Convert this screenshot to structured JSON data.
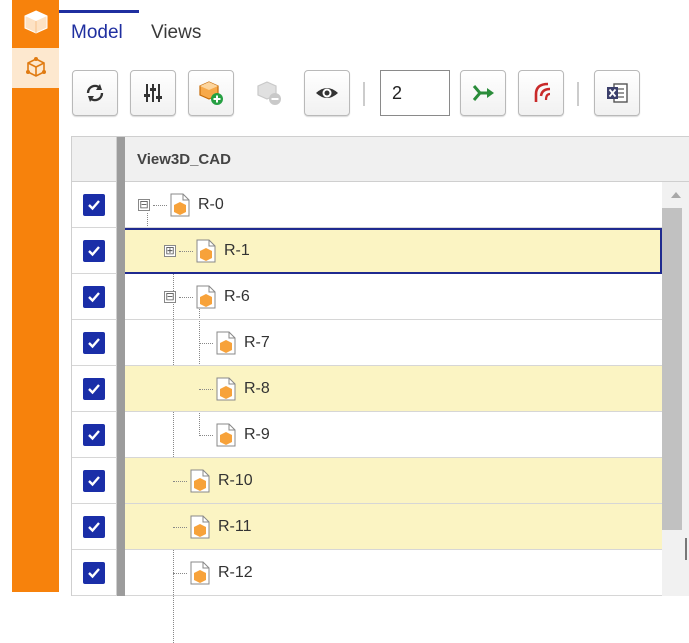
{
  "sidebar": {
    "items": [
      {
        "icon": "cube-icon",
        "state": "active"
      },
      {
        "icon": "model-tree-icon",
        "state": "selected"
      }
    ]
  },
  "tabs": [
    {
      "label": "Model",
      "active": true
    },
    {
      "label": "Views",
      "active": false
    }
  ],
  "toolbar": {
    "buttons": [
      {
        "icon": "refresh-icon"
      },
      {
        "icon": "sliders-icon"
      },
      {
        "icon": "add-part-icon"
      },
      {
        "icon": "remove-part-icon",
        "disabled": true
      },
      {
        "icon": "eye-icon"
      },
      {
        "icon": "expand-level-icon"
      },
      {
        "icon": "collapse-level-icon"
      },
      {
        "icon": "excel-export-icon"
      }
    ],
    "level_value": "2"
  },
  "grid": {
    "column_header": "View3D_CAD",
    "rows": [
      {
        "label": "R-0",
        "checked": true,
        "expander": "⊟"
      },
      {
        "label": "R-1",
        "checked": true,
        "expander": "⊞",
        "selected": true
      },
      {
        "label": "R-6",
        "checked": true,
        "expander": "⊟"
      },
      {
        "label": "R-7",
        "checked": true
      },
      {
        "label": "R-8",
        "checked": true
      },
      {
        "label": "R-9",
        "checked": true
      },
      {
        "label": "R-10",
        "checked": true
      },
      {
        "label": "R-11",
        "checked": true
      },
      {
        "label": "R-12",
        "checked": true
      }
    ]
  },
  "colors": {
    "accent": "#f7820c",
    "primary": "#1f2fa0",
    "row_highlight": "#fbf4c3",
    "checkbox": "#1a2ea8"
  }
}
